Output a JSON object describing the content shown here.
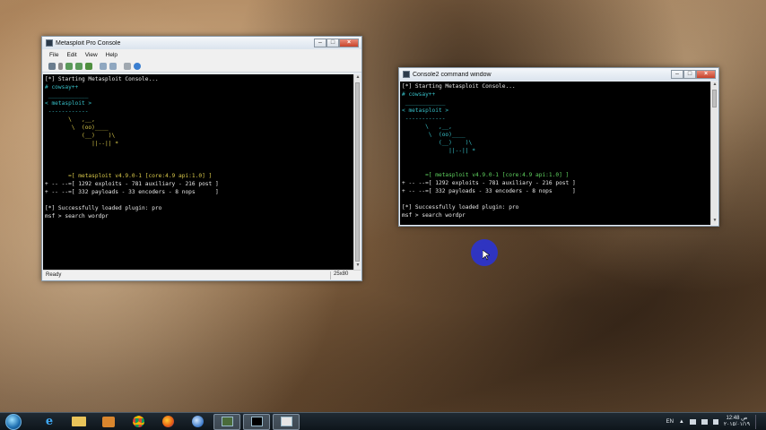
{
  "window1": {
    "title": "Metasploit Pro Console",
    "menu": [
      "File",
      "Edit",
      "View",
      "Help"
    ],
    "lines": [
      {
        "t": "[*] Starting Metasploit Console...",
        "c": "white"
      },
      {
        "t": "# cowsay++",
        "c": "cyan"
      },
      {
        "t": " ____________",
        "c": "cyan"
      },
      {
        "t": "< metasploit >",
        "c": "cyan"
      },
      {
        "t": " ------------",
        "c": "cyan"
      },
      {
        "t": "       \\   ,__,",
        "c": "yellow"
      },
      {
        "t": "        \\  (oo)____",
        "c": "yellow"
      },
      {
        "t": "           (__)    )\\",
        "c": "yellow"
      },
      {
        "t": "              ||--|| *",
        "c": "yellow"
      },
      {
        "t": "",
        "c": "white"
      },
      {
        "t": "",
        "c": "white"
      },
      {
        "t": "",
        "c": "white"
      },
      {
        "t": "       =[ metasploit v4.9.0-1 [core:4.9 api:1.0] ]",
        "c": "yellow"
      },
      {
        "t": "+ -- --=[ 1292 exploits - 781 auxiliary - 216 post ]",
        "c": "white"
      },
      {
        "t": "+ -- --=[ 332 payloads - 33 encoders - 8 nops      ]",
        "c": "white"
      },
      {
        "t": "",
        "c": "white"
      },
      {
        "t": "[*] Successfully loaded plugin: pro",
        "c": "white"
      },
      {
        "t": "msf > search wordpr",
        "c": "white"
      }
    ],
    "status_left": "Ready",
    "status_right": "25x80"
  },
  "window2": {
    "title": "Console2 command window",
    "lines": [
      {
        "t": "[*] Starting Metasploit Console...",
        "c": "white"
      },
      {
        "t": "# cowsay++",
        "c": "cyan"
      },
      {
        "t": " ____________",
        "c": "cyan"
      },
      {
        "t": "< metasploit >",
        "c": "cyan"
      },
      {
        "t": " ------------",
        "c": "cyan"
      },
      {
        "t": "       \\   ,__,",
        "c": "cyan"
      },
      {
        "t": "        \\  (oo)____",
        "c": "cyan"
      },
      {
        "t": "           (__)    )\\",
        "c": "cyan"
      },
      {
        "t": "              ||--|| *",
        "c": "cyan"
      },
      {
        "t": "",
        "c": "white"
      },
      {
        "t": "",
        "c": "white"
      },
      {
        "t": "       =[ metasploit v4.9.0-1 [core:4.9 api:1.0] ]",
        "c": "green"
      },
      {
        "t": "+ -- --=[ 1292 exploits - 781 auxiliary - 216 post ]",
        "c": "white"
      },
      {
        "t": "+ -- --=[ 332 payloads - 33 encoders - 8 nops      ]",
        "c": "white"
      },
      {
        "t": "",
        "c": "white"
      },
      {
        "t": "[*] Successfully loaded plugin: pro",
        "c": "white"
      },
      {
        "t": "msf > search wordpr",
        "c": "white"
      }
    ]
  },
  "taskbar": {
    "language": "EN",
    "time": "12:48",
    "ampm": "ص",
    "date": "٢٠١٥/٠١/١٩"
  },
  "colors": {
    "white": "#e8e8e8",
    "cyan": "#37c0c8",
    "green": "#5fd35f",
    "yellow": "#d9c84a",
    "taskbar": "#131c23"
  },
  "icons": {
    "taskbar": [
      "windows-start-icon",
      "ie-icon",
      "explorer-folder-icon",
      "media-player-icon",
      "chrome-icon",
      "firefox-icon",
      "thunderbird-icon",
      "console-icon",
      "terminal-icon",
      "window-icon"
    ]
  }
}
